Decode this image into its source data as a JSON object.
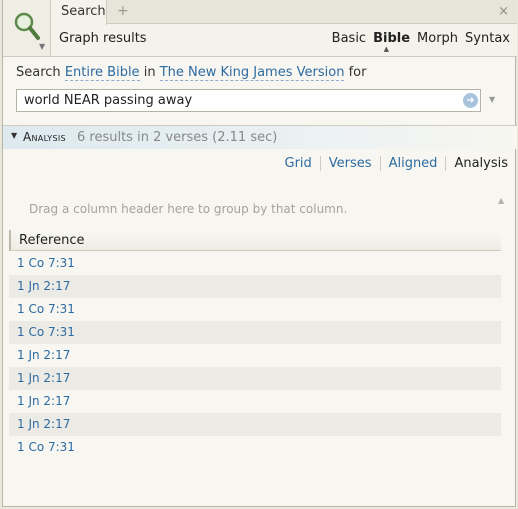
{
  "header": {
    "tab_label": "Search",
    "tab_add": "+",
    "tab_close": "×",
    "subtitle": "Graph results",
    "modes": [
      "Basic",
      "Bible",
      "Morph",
      "Syntax"
    ],
    "active_mode": "Bible"
  },
  "search": {
    "prefix": "Search",
    "scope": "Entire Bible",
    "in_word": "in",
    "version": "The New King James Version",
    "for_word": "for",
    "query": "world NEAR passing away"
  },
  "analysis": {
    "title": "Analysis",
    "summary": "6 results in 2 verses (2.11 sec)"
  },
  "views": [
    "Grid",
    "Verses",
    "Aligned",
    "Analysis"
  ],
  "current_view": "Analysis",
  "grid": {
    "group_hint": "Drag a column header here to group by that column.",
    "column_header": "Reference",
    "rows": [
      "1 Co 7:31",
      "1 Jn 2:17",
      "1 Co 7:31",
      "1 Co 7:31",
      "1 Jn 2:17",
      "1 Jn 2:17",
      "1 Jn 2:17",
      "1 Jn 2:17",
      "1 Co 7:31"
    ]
  },
  "colors": {
    "link": "#2d6ba1",
    "alt_row": "#ebeae5",
    "hint": "#a5a398"
  }
}
